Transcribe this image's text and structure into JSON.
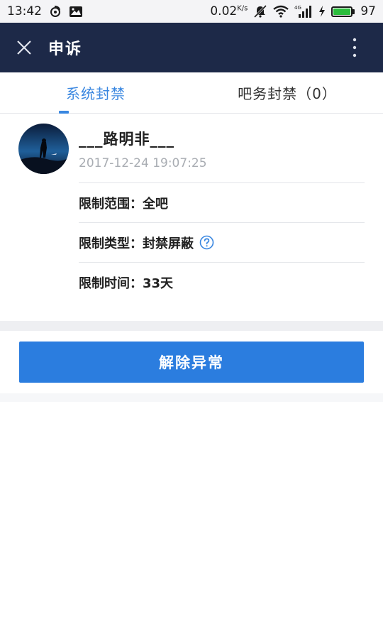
{
  "status_bar": {
    "time": "13:42",
    "net_speed": "0.02",
    "net_unit": "K/s",
    "battery_level": "97",
    "battery_fraction": 0.97,
    "icons": [
      "weibo-icon",
      "gallery-icon",
      "mute-icon",
      "wifi-icon",
      "signal-4g-icon",
      "charging-icon",
      "battery-icon"
    ]
  },
  "app_bar": {
    "title": "申诉",
    "background_color": "#1d2948"
  },
  "tabs": [
    {
      "label": "系统封禁",
      "active": true
    },
    {
      "label": "吧务封禁（0）",
      "active": false
    }
  ],
  "record": {
    "username": "___路明非___",
    "timestamp": "2017-12-24 19:07:25",
    "rows": [
      {
        "label": "限制范围：",
        "value": "全吧"
      },
      {
        "label": "限制类型：",
        "value": "封禁屏蔽",
        "has_help": true
      },
      {
        "label": "限制时间：",
        "value": "33天"
      }
    ]
  },
  "action": {
    "button_label": "解除异常"
  },
  "colors": {
    "accent": "#3a87e0",
    "button": "#2b7ddf",
    "muted_text": "#a9adb3"
  }
}
